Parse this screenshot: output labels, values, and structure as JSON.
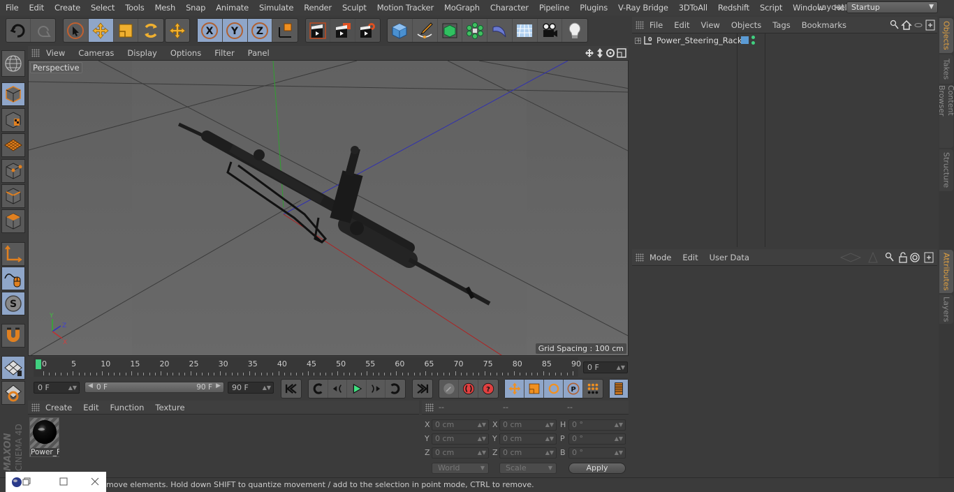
{
  "menubar": {
    "items": [
      "File",
      "Edit",
      "Create",
      "Select",
      "Tools",
      "Mesh",
      "Snap",
      "Animate",
      "Simulate",
      "Render",
      "Sculpt",
      "Motion Tracker",
      "MoGraph",
      "Character",
      "Pipeline",
      "Plugins",
      "V-Ray Bridge",
      "3DToAll",
      "Redshift",
      "Script",
      "Window",
      "Help"
    ],
    "layout_label": "Layout:",
    "layout_value": "Startup"
  },
  "toolbar": {
    "icons": [
      "undo-icon",
      "redo-icon",
      "live-selection-icon",
      "move-icon",
      "scale-icon",
      "rotate-icon",
      "recent-tool-icon",
      "x-axis-icon",
      "y-axis-icon",
      "z-axis-icon",
      "coordinate-system-icon",
      "render-view-icon",
      "render-picture-viewer-icon",
      "render-settings-icon",
      "cube-icon",
      "pen-icon",
      "subdivision-icon",
      "cloner-icon",
      "deformer-icon",
      "floor-icon",
      "camera-icon",
      "light-icon"
    ]
  },
  "left_toolbar": {
    "icons": [
      "make-editable-icon",
      "model-mode-icon",
      "texture-mode-icon",
      "workplane-icon",
      "points-mode-icon",
      "edges-mode-icon",
      "polygons-mode-icon",
      "axis-icon",
      "tweak-icon",
      "solo-icon",
      "snap-icon",
      "snap-settings-icon",
      "quantize-icon"
    ]
  },
  "viewport": {
    "menu": [
      "View",
      "Cameras",
      "Display",
      "Options",
      "Filter",
      "Panel"
    ],
    "camera_label": "Perspective",
    "grid_spacing": "Grid Spacing : 100 cm",
    "axis_labels": {
      "x": "X",
      "y": "Y",
      "z": "Z"
    }
  },
  "timeline": {
    "ticks": [
      "0",
      "5",
      "10",
      "15",
      "20",
      "25",
      "30",
      "35",
      "40",
      "45",
      "50",
      "55",
      "60",
      "65",
      "70",
      "75",
      "80",
      "85",
      "90"
    ],
    "current_frame": "0 F",
    "start_field": "0 F",
    "range_start": "0 F",
    "range_end": "90 F",
    "end_field": "90 F"
  },
  "materials": {
    "menu": [
      "Create",
      "Edit",
      "Function",
      "Texture"
    ],
    "items": [
      {
        "name": "Power_F"
      }
    ]
  },
  "coordinates": {
    "headers": [
      "--",
      "--",
      "--"
    ],
    "rows": [
      {
        "l1": "X",
        "v1": "0 cm",
        "l2": "X",
        "v2": "0 cm",
        "l3": "H",
        "v3": "0 °"
      },
      {
        "l1": "Y",
        "v1": "0 cm",
        "l2": "Y",
        "v2": "0 cm",
        "l3": "P",
        "v3": "0 °"
      },
      {
        "l1": "Z",
        "v1": "0 cm",
        "l2": "Z",
        "v2": "0 cm",
        "l3": "B",
        "v3": "0 °"
      }
    ],
    "space_dropdown": "World",
    "mode_dropdown": "Scale",
    "apply_label": "Apply"
  },
  "objects_panel": {
    "menu": [
      "File",
      "Edit",
      "View",
      "Objects",
      "Tags",
      "Bookmarks"
    ],
    "objects": [
      {
        "name": "Power_Steering_Rack",
        "color": "#5b9bd5"
      }
    ]
  },
  "attributes_panel": {
    "menu": [
      "Mode",
      "Edit",
      "User Data"
    ]
  },
  "side_tabs": {
    "top": [
      "Objects",
      "Takes",
      "Content Browser",
      "Structure"
    ],
    "bottom": [
      "Attributes",
      "Layers"
    ]
  },
  "status": {
    "text": "move elements. Hold down SHIFT to quantize movement / add to the selection in point mode, CTRL to remove."
  },
  "branding": {
    "maxon": "MAXON",
    "product": "CINEMA 4D"
  },
  "colors": {
    "accent": "#8fa6c9",
    "active_tab": "#e0a040",
    "x_axis": "#c03030",
    "y_axis": "#30a030",
    "z_axis": "#3030b0"
  }
}
